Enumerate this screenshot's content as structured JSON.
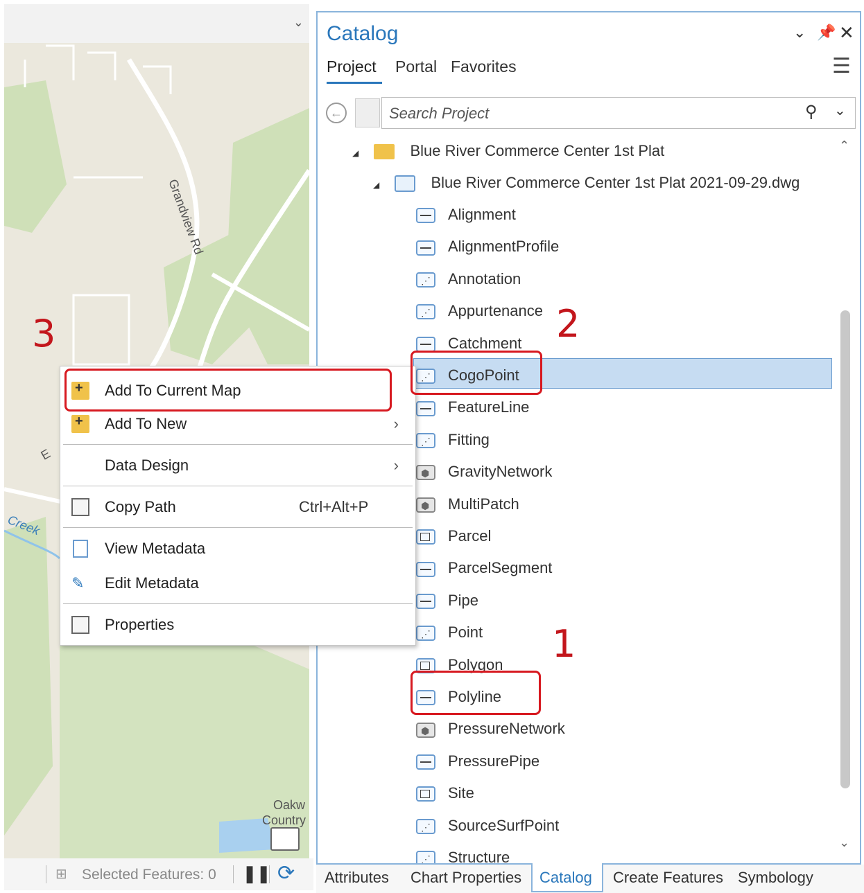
{
  "map": {
    "road_label_1": "Grandview Rd",
    "creek_label": "Creek",
    "place_label_1": "Oakw",
    "place_label_2": "Country",
    "short_label": "E"
  },
  "statusbar": {
    "selected_features": "Selected Features: 0"
  },
  "catalog": {
    "title": "Catalog",
    "tabs": [
      "Project",
      "Portal",
      "Favorites"
    ],
    "search_placeholder": "Search Project",
    "tree": {
      "folder": "Blue River Commerce Center 1st Plat",
      "dataset": "Blue River Commerce Center 1st Plat 2021-09-29.dwg",
      "items": [
        {
          "label": "Alignment",
          "icon": "line"
        },
        {
          "label": "AlignmentProfile",
          "icon": "line"
        },
        {
          "label": "Annotation",
          "icon": "point"
        },
        {
          "label": "Appurtenance",
          "icon": "point"
        },
        {
          "label": "Catchment",
          "icon": "line"
        },
        {
          "label": "CogoPoint",
          "icon": "point",
          "selected": true
        },
        {
          "label": "FeatureLine",
          "icon": "line"
        },
        {
          "label": "Fitting",
          "icon": "point"
        },
        {
          "label": "GravityNetwork",
          "icon": "multipatch"
        },
        {
          "label": "MultiPatch",
          "icon": "multipatch"
        },
        {
          "label": "Parcel",
          "icon": "polygon"
        },
        {
          "label": "ParcelSegment",
          "icon": "line"
        },
        {
          "label": "Pipe",
          "icon": "line"
        },
        {
          "label": "Point",
          "icon": "point"
        },
        {
          "label": "Polygon",
          "icon": "polygon"
        },
        {
          "label": "Polyline",
          "icon": "line"
        },
        {
          "label": "PressureNetwork",
          "icon": "multipatch"
        },
        {
          "label": "PressurePipe",
          "icon": "line"
        },
        {
          "label": "Site",
          "icon": "polygon"
        },
        {
          "label": "SourceSurfPoint",
          "icon": "point"
        },
        {
          "label": "Structure",
          "icon": "point"
        }
      ]
    }
  },
  "bottom_tabs": [
    "Attributes",
    "Chart Properties",
    "Catalog",
    "Create Features",
    "Symbology"
  ],
  "context_menu": {
    "add_to_current_map": "Add To Current Map",
    "add_to_new": "Add To New",
    "data_design": "Data Design",
    "copy_path": "Copy Path",
    "copy_path_shortcut": "Ctrl+Alt+P",
    "view_metadata": "View Metadata",
    "edit_metadata": "Edit Metadata",
    "properties": "Properties"
  },
  "annotations": {
    "step1": "1",
    "step2": "2",
    "step3": "3"
  },
  "colors": {
    "accent": "#2a77bb",
    "selection": "#c6dcf2",
    "annotation_red": "#d71920"
  }
}
